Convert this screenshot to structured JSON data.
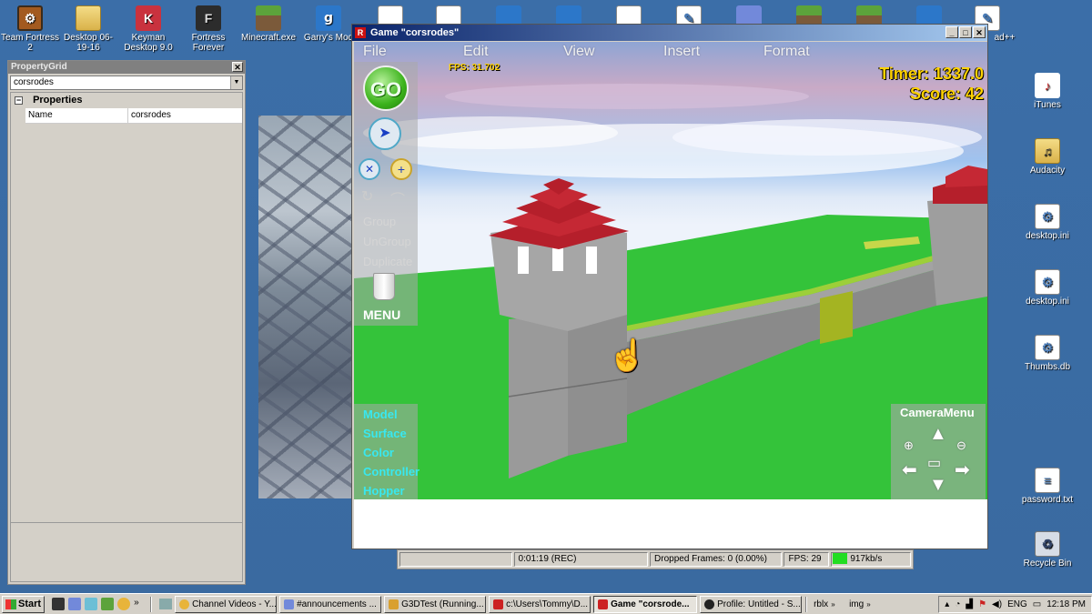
{
  "desktop_icons_top": [
    {
      "label": "Team Fortress 2",
      "icon": "team-fortress-icon"
    },
    {
      "label": "Desktop 06-19-16",
      "icon": "folder-icon"
    },
    {
      "label": "Keyman Desktop 9.0",
      "icon": "keyman-icon"
    },
    {
      "label": "Fortress Forever",
      "icon": "fortress-forever-icon"
    },
    {
      "label": "Minecraft.exe",
      "icon": "minecraft-icon"
    },
    {
      "label": "Garry's Mod",
      "icon": "garrys-mod-icon"
    }
  ],
  "desktop_icons_right": [
    {
      "label": "iTunes",
      "icon": "itunes-icon"
    },
    {
      "label": "Audacity",
      "icon": "audacity-icon"
    },
    {
      "label": "desktop.ini",
      "icon": "ini-file-icon"
    },
    {
      "label": "desktop.ini",
      "icon": "ini-file-icon"
    },
    {
      "label": "Thumbs.db",
      "icon": "db-file-icon"
    },
    {
      "label": "password.txt",
      "icon": "text-file-icon"
    },
    {
      "label": "Recycle Bin",
      "icon": "recycle-bin-icon"
    }
  ],
  "partial_icon_label": "ad++",
  "property_grid": {
    "title": "PropertyGrid",
    "selected_object": "corsrodes",
    "category": "Properties",
    "rows": [
      {
        "key": "Name",
        "value": "corsrodes"
      }
    ]
  },
  "game_window": {
    "title": "Game \"corsrodes\"",
    "menu": [
      "File",
      "Edit",
      "View",
      "Insert",
      "Format"
    ],
    "fps_label": "FPS: 31.702",
    "timer_label": "Timer: 1337.0",
    "score_label": "Score: 42",
    "go_label": "GO",
    "tool_labels": [
      "Group",
      "UnGroup",
      "Duplicate"
    ],
    "menu_label": "MENU",
    "bottom_tools": [
      "Model",
      "Surface",
      "Color",
      "Controller",
      "Hopper"
    ],
    "camera_menu_label": "CameraMenu"
  },
  "recorder": {
    "time": "0:01:19 (REC)",
    "dropped": "Dropped Frames: 0 (0.00%)",
    "fps": "FPS: 29",
    "bitrate": "917kb/s"
  },
  "taskbar": {
    "start_label": "Start",
    "buttons": [
      {
        "label": "Channel Videos - Y...",
        "icon": "chrome-icon",
        "color": "#e8b43a"
      },
      {
        "label": "#announcements ...",
        "icon": "discord-icon",
        "color": "#7289da"
      },
      {
        "label": "G3DTest (Running...",
        "icon": "g3d-icon",
        "color": "#d9a030"
      },
      {
        "label": "c:\\Users\\Tommy\\D...",
        "icon": "roblox-icon",
        "color": "#cc2222"
      },
      {
        "label": "Game \"corsrode...",
        "icon": "roblox-icon",
        "color": "#cc2222",
        "active": true
      },
      {
        "label": "Profile: Untitled - S...",
        "icon": "obs-icon",
        "color": "#222222"
      }
    ],
    "extra_buttons": [
      "rblx",
      "img"
    ],
    "language": "ENG",
    "clock": "12:18 PM"
  }
}
